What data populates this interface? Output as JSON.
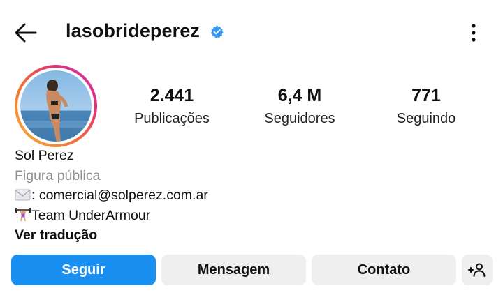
{
  "header": {
    "username": "lasobrideperez",
    "verified": true,
    "icons": {
      "back": "arrow-left-icon",
      "verified": "verified-badge-icon",
      "more": "more-vertical-icon"
    }
  },
  "stats": [
    {
      "value": "2.441",
      "label": "Publicações"
    },
    {
      "value": "6,4 M",
      "label": "Seguidores"
    },
    {
      "value": "771",
      "label": "Seguindo"
    }
  ],
  "bio": {
    "name": "Sol Perez",
    "category": "Figura pública",
    "contact_line": ": comercial@solperez.com.ar",
    "contact_emoji": "envelope-icon",
    "team_line": "Team UnderArmour",
    "team_emoji": "weightlifter-icon",
    "translate": "Ver tradução"
  },
  "actions": {
    "follow": "Seguir",
    "message": "Mensagem",
    "contact": "Contato",
    "add_user_icon": "add-user-icon"
  },
  "colors": {
    "accent_blue": "#1a8ff2",
    "button_gray": "#efefef",
    "secondary_text": "#8e8e8e",
    "verified_blue": "#3897f0"
  }
}
